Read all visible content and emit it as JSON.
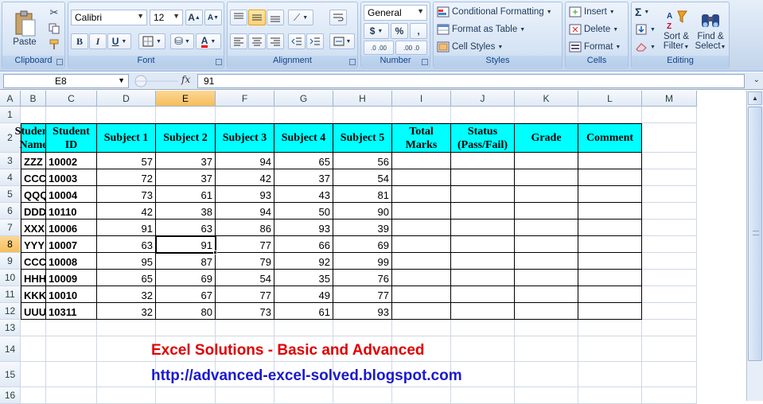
{
  "ribbon": {
    "clipboard": {
      "label": "Clipboard",
      "paste": "Paste"
    },
    "font": {
      "label": "Font",
      "name": "Calibri",
      "size": "12",
      "bold": "B",
      "italic": "I",
      "underline": "U",
      "grow": "A",
      "shrink": "A"
    },
    "alignment": {
      "label": "Alignment"
    },
    "number": {
      "label": "Number",
      "format": "General",
      "currency": "$",
      "percent": "%",
      "comma": ",",
      "inc_dec": ".0 .00",
      "dec_dec": ".00 .0"
    },
    "styles": {
      "label": "Styles",
      "conditional": "Conditional Formatting",
      "table": "Format as Table",
      "cell_styles": "Cell Styles"
    },
    "cells": {
      "label": "Cells",
      "insert": "Insert",
      "delete": "Delete",
      "format": "Format"
    },
    "editing": {
      "label": "Editing",
      "sigma": "Σ",
      "sort": "Sort &",
      "filter": "Filter",
      "find": "Find &",
      "select": "Select"
    }
  },
  "formula_bar": {
    "name_box": "E8",
    "fx": "fx",
    "value": "91"
  },
  "columns": [
    "A",
    "B",
    "C",
    "D",
    "E",
    "F",
    "G",
    "H",
    "I",
    "J",
    "K",
    "L",
    "M"
  ],
  "rows": [
    "1",
    "2",
    "3",
    "4",
    "5",
    "6",
    "7",
    "8",
    "9",
    "10",
    "11",
    "12",
    "13",
    "14",
    "15",
    "16"
  ],
  "table": {
    "headers": [
      "Student Name",
      "Student ID",
      "Subject 1",
      "Subject 2",
      "Subject 3",
      "Subject 4",
      "Subject 5",
      "Total Marks",
      "Status (Pass/Fail)",
      "Grade",
      "Comment"
    ],
    "rows": [
      [
        "ZZZ",
        "10002",
        "57",
        "37",
        "94",
        "65",
        "56"
      ],
      [
        "CCC",
        "10003",
        "72",
        "37",
        "42",
        "37",
        "54"
      ],
      [
        "QQQ",
        "10004",
        "73",
        "61",
        "93",
        "43",
        "81"
      ],
      [
        "DDD",
        "10110",
        "42",
        "38",
        "94",
        "50",
        "90"
      ],
      [
        "XXX",
        "10006",
        "91",
        "63",
        "86",
        "93",
        "39"
      ],
      [
        "YYY",
        "10007",
        "63",
        "91",
        "77",
        "66",
        "69"
      ],
      [
        "CCC",
        "10008",
        "95",
        "87",
        "79",
        "92",
        "99"
      ],
      [
        "HHH",
        "10009",
        "65",
        "69",
        "54",
        "35",
        "76"
      ],
      [
        "KKK",
        "10010",
        "32",
        "67",
        "77",
        "49",
        "77"
      ],
      [
        "UUU",
        "10311",
        "32",
        "80",
        "73",
        "61",
        "93"
      ]
    ]
  },
  "banner": {
    "title": "Excel Solutions - Basic and Advanced",
    "url": "http://advanced-excel-solved.blogspot.com"
  },
  "colors": {
    "header_fill": "#00ffff",
    "title_red": "#e00000",
    "url_blue": "#1a1acc",
    "selected_header": "#f6bd5c"
  }
}
